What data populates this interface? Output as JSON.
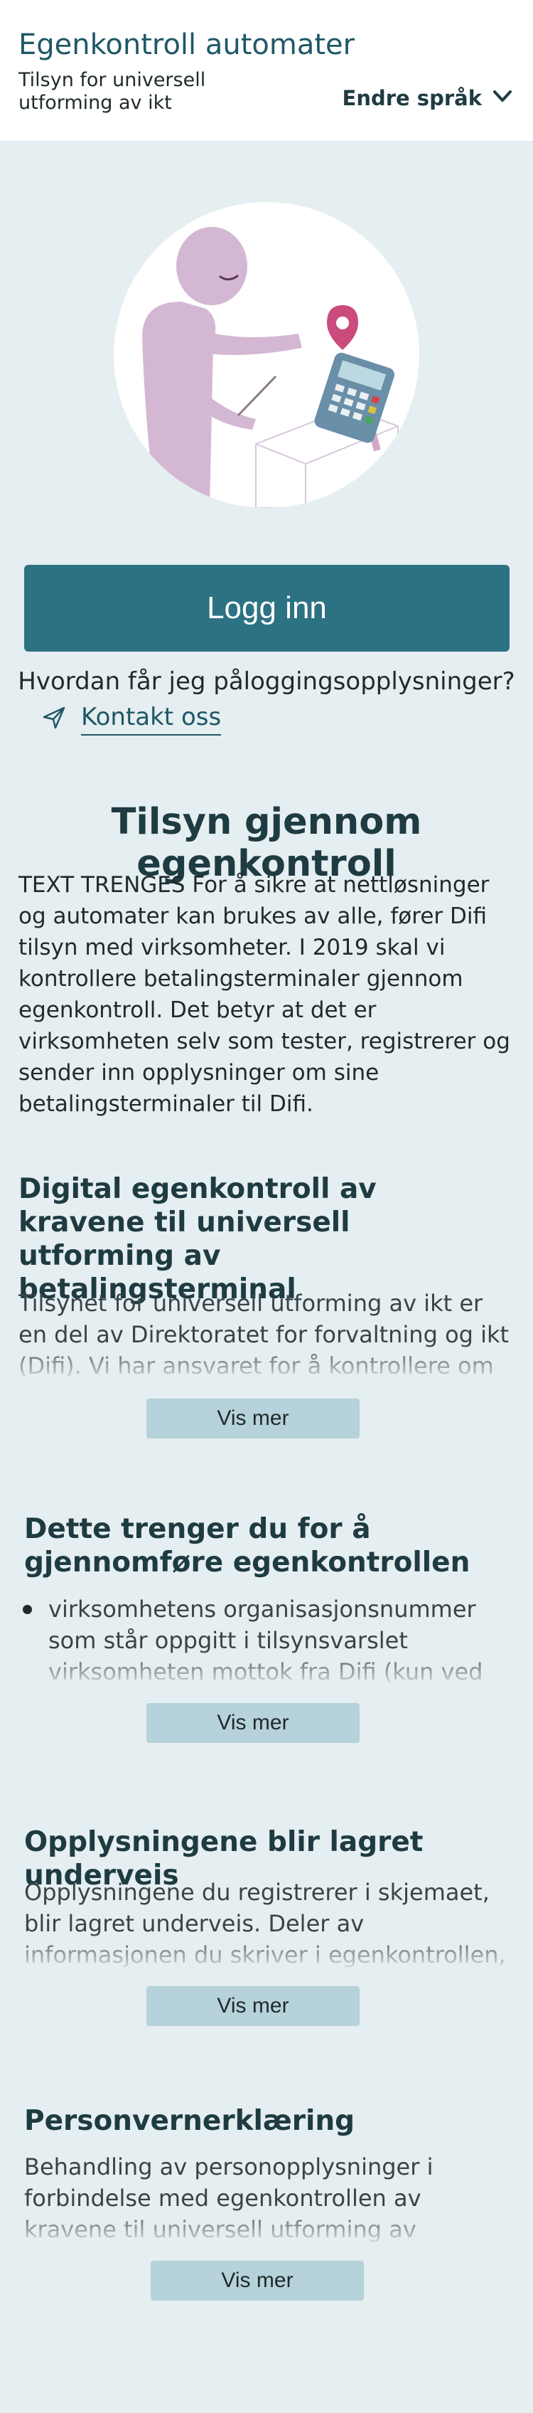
{
  "header": {
    "title": "Egenkontroll automater",
    "subtitle": "Tilsyn for universell utforming av ikt",
    "language_label": "Endre språk",
    "language_icon": "chevron-down-icon"
  },
  "hero": {
    "illustration": "person-at-payment-terminal-illustration"
  },
  "login": {
    "button_label": "Logg inn",
    "help_text": "Hvordan får jeg påloggingsopplysninger?",
    "contact_label": "Kontakt oss",
    "contact_icon": "send-icon"
  },
  "main": {
    "heading": "Tilsyn gjennom egenkontroll",
    "intro": "TEXT TRENGES For å sikre at nettløsninger og automater kan brukes av alle, fører Difi tilsyn med virksomheter. I 2019 skal vi kontrollere betalingsterminaler gjennom egenkontroll. Det betyr at det er virksomheten selv som tester, registrerer og sender inn opplysninger om sine betalingsterminaler til Difi."
  },
  "sections": [
    {
      "heading": "Digital egenkontroll av kravene til universell utforming av betalingsterminal",
      "body": "Tilsynet for universell utforming av ikt er en del av Direktoratet for forvaltning og ikt (Difi). Vi har ansvaret for å kontrollere om nettsider",
      "more_label": "Vis mer"
    },
    {
      "heading": "Dette trenger du for å gjennomføre egenkontrollen",
      "bullet": "virksomhetens organisasjonsnummer som står oppgitt i tilsynsvarslet virksomheten mottok fra Difi (kun ved første gangs",
      "more_label": "Vis mer"
    },
    {
      "heading": "Opplysningene blir lagret underveis",
      "body": "Opplysningene du registrerer i skjemaet, blir lagret underveis. Deler av informasjonen du skriver i egenkontrollen, skal i tillegg",
      "more_label": "Vis mer"
    },
    {
      "heading": "Personvernerklæring",
      "body": "Behandling av personopplysninger i forbindelse med egenkontrollen av kravene til universell utforming av betalingsterminaler",
      "more_label": "Vis mer"
    }
  ],
  "colors": {
    "header_bg": "#ffffff",
    "page_bg": "#e5eef0",
    "primary": "#2d7283",
    "heading": "#1f3b42",
    "title": "#1f5866",
    "secondary_button": "#b6d2da"
  }
}
